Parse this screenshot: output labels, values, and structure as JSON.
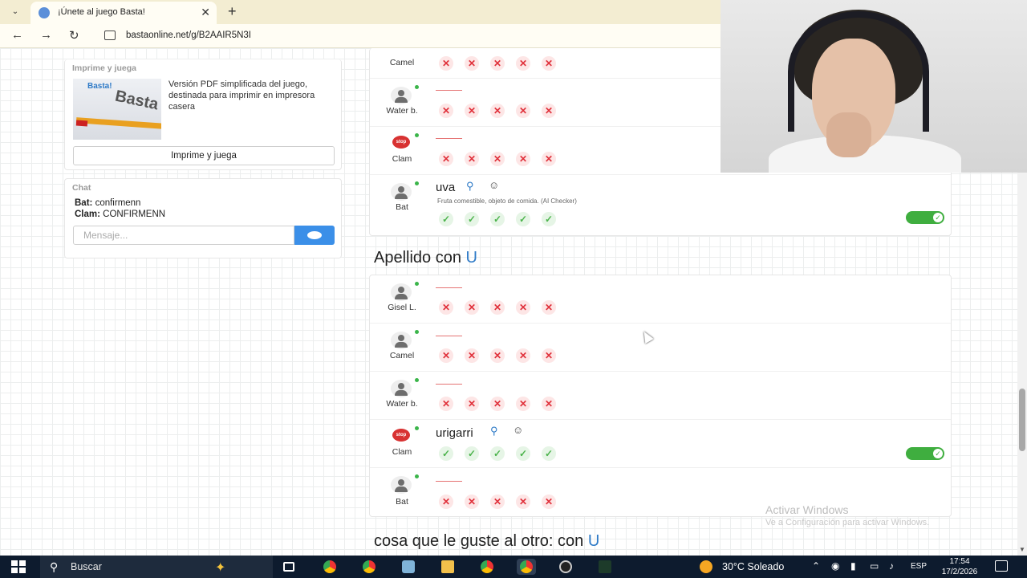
{
  "browser": {
    "tab_title": "¡Únete al juego Basta!",
    "tab_close": "✕",
    "new_tab": "+",
    "back": "←",
    "forward": "→",
    "reload": "↻",
    "url": "bastaonline.net/g/B2AAIR5N3I"
  },
  "sidebar": {
    "print_card": {
      "heading": "Imprime y juega",
      "image_logo": "Basta!",
      "image_word": "Basta",
      "description": "Versión PDF simplificada del juego, destinada para imprimir en impresora casera",
      "button_label": "Imprime y juega"
    },
    "chat": {
      "heading": "Chat",
      "messages": [
        {
          "user": "Bat:",
          "text": " confirmenn"
        },
        {
          "user": "Clam:",
          "text": " CONFIRMENN"
        }
      ],
      "input_placeholder": "Mensaje..."
    }
  },
  "rounds": [
    {
      "title": "",
      "players": [
        {
          "name": "Camel",
          "answer": "",
          "valid": false,
          "stop": false
        },
        {
          "name": "Water b.",
          "answer": "",
          "valid": false,
          "stop": false
        },
        {
          "name": "Clam",
          "answer": "",
          "valid": false,
          "stop": true
        },
        {
          "name": "Bat",
          "answer": "uva",
          "note": "Fruta comestible, objeto de comida. (AI Checker)",
          "valid": true,
          "stop": false
        }
      ]
    },
    {
      "title": "Apellido con",
      "letter": "U",
      "players": [
        {
          "name": "Gisel L.",
          "answer": "",
          "valid": false,
          "stop": false
        },
        {
          "name": "Camel",
          "answer": "",
          "valid": false,
          "stop": false
        },
        {
          "name": "Water b.",
          "answer": "",
          "valid": false,
          "stop": false
        },
        {
          "name": "Clam",
          "answer": "urigarri",
          "valid": true,
          "stop": true
        },
        {
          "name": "Bat",
          "answer": "",
          "valid": false,
          "stop": false
        }
      ]
    },
    {
      "title": "cosa que le guste al otro: con",
      "letter": "U"
    }
  ],
  "marks": {
    "x": "✕",
    "ok": "✓",
    "stop_badge": "stop"
  },
  "watermark": {
    "line1": "Activar Windows",
    "line2": "Ve a Configuración para activar Windows."
  },
  "taskbar": {
    "search_label": "Buscar",
    "weather": "30°C  Soleado",
    "language": "ESP",
    "time": "17:54",
    "date": "17/2/2026"
  },
  "colors": {
    "accent": "#2e7ac7",
    "toggle_on": "#3fae3f",
    "x_mark": "#e0303a",
    "ok_mark": "#4cb34c"
  }
}
